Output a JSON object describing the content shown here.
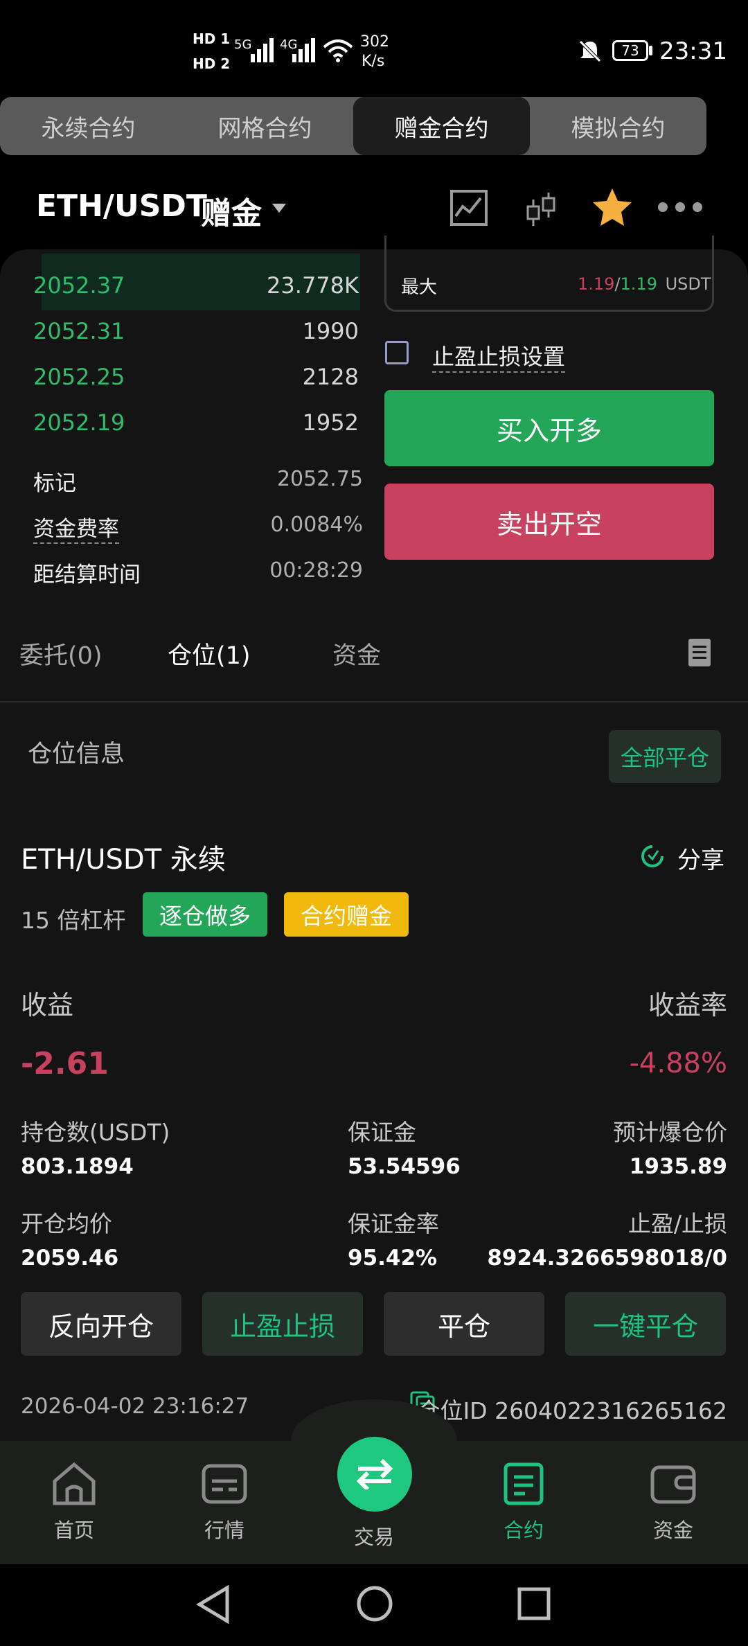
{
  "status_bar": {
    "hd1": "HD 1",
    "hd2": "HD 2",
    "net1": "5G",
    "net2": "4G",
    "speed_value": "302",
    "speed_unit": "K/s",
    "battery": "73",
    "time": "23:31"
  },
  "tabs": [
    {
      "label": "永续合约"
    },
    {
      "label": "网格合约"
    },
    {
      "label": "赠金合约"
    },
    {
      "label": "模拟合约"
    }
  ],
  "header": {
    "pair": "ETH/USDT",
    "pair_sub": "赠金",
    "icons": [
      "chart-icon",
      "candlestick-icon",
      "star-icon",
      "more-icon"
    ]
  },
  "orderbook": {
    "rows": [
      {
        "price": "2052.37",
        "qty": "23.778K"
      },
      {
        "price": "2052.31",
        "qty": "1990"
      },
      {
        "price": "2052.25",
        "qty": "2128"
      },
      {
        "price": "2052.19",
        "qty": "1952"
      }
    ]
  },
  "market_info": [
    {
      "label": "标记",
      "value": "2052.75"
    },
    {
      "label": "资金费率",
      "value": "0.0084%"
    },
    {
      "label": "距结算时间",
      "value": "00:28:29"
    }
  ],
  "order_form": {
    "max_label": "最大",
    "max_buy": "1.19",
    "max_sell": "1.19",
    "max_unit": "USDT",
    "tpsl_label": "止盈止损设置",
    "buy_label": "买入开多",
    "sell_label": "卖出开空"
  },
  "sub_tabs": [
    {
      "label": "委托(0)"
    },
    {
      "label": "仓位(1)"
    },
    {
      "label": "资金"
    }
  ],
  "position_section": {
    "title": "仓位信息",
    "close_all": "全部平仓"
  },
  "position": {
    "symbol": "ETH/USDT 永续",
    "share": "分享",
    "leverage": "15 倍杠杆",
    "badge_side": "逐仓做多",
    "badge_bonus": "合约赠金",
    "pnl_label": "收益",
    "pnl_value": "-2.61",
    "roe_label": "收益率",
    "roe_value": "-4.88%",
    "size_label": "持仓数(USDT)",
    "size_value": "803.1894",
    "margin_label": "保证金",
    "margin_value": "53.54596",
    "liq_label": "预计爆仓价",
    "liq_value": "1935.89",
    "entry_label": "开仓均价",
    "entry_value": "2059.46",
    "margin_ratio_label": "保证金率",
    "margin_ratio_value": "95.42%",
    "tpsl_label": "止盈/止损",
    "tpsl_value": "8924.3266598018/0",
    "buttons": [
      "反向开仓",
      "止盈止损",
      "平仓",
      "一键平仓"
    ],
    "timestamp": "2026-04-02 23:16:27",
    "position_id": "仓位ID 2604022316265162"
  },
  "bottom_nav": [
    {
      "label": "首页"
    },
    {
      "label": "行情"
    },
    {
      "label": "交易"
    },
    {
      "label": "合约"
    },
    {
      "label": "资金"
    }
  ],
  "colors": {
    "green": "#2ebd6b",
    "red": "#c8415f",
    "yellow": "#f0b90b",
    "accent": "#1fc27e"
  }
}
